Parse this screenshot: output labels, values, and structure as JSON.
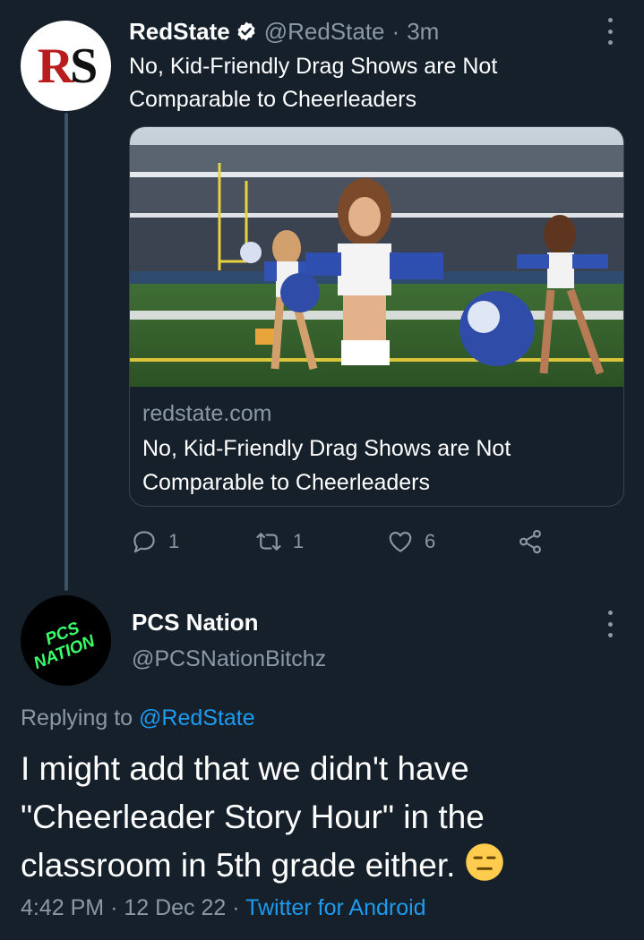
{
  "tweet1": {
    "avatar_text": "RS",
    "name": "RedState",
    "handle": "@RedState",
    "separator": "·",
    "time": "3m",
    "text": "No, Kid-Friendly Drag Shows are Not Comparable to Cheerleaders",
    "card": {
      "domain": "redstate.com",
      "title": "No, Kid-Friendly Drag Shows are Not Comparable to Cheerleaders",
      "image_alt": "photo of cheerleaders in a stadium"
    },
    "actions": {
      "replies": "1",
      "retweets": "1",
      "likes": "6"
    },
    "icons": [
      "verified-icon",
      "more-icon",
      "reply-icon",
      "retweet-icon",
      "like-icon",
      "share-icon"
    ]
  },
  "tweet2": {
    "avatar_text_line1": "PCS",
    "avatar_text_line2": "NATION",
    "name": "PCS Nation",
    "handle": "@PCSNationBitchz",
    "replying_prefix": "Replying to",
    "replying_to": "@RedState",
    "text": "I might add that we didn't have \"Cheerleader Story Hour\" in the classroom in 5th grade either.",
    "emoji": "expressionless-face",
    "time": "4:42 PM",
    "separator": "·",
    "date": "12 Dec 22",
    "source": "Twitter for Android"
  },
  "colors": {
    "background": "#15202b",
    "text": "#ffffff",
    "muted": "#8b98a5",
    "link": "#1d9bf0",
    "border": "#38444d",
    "rs_red": "#b91c1c",
    "pcs_green": "#39ff6a"
  }
}
